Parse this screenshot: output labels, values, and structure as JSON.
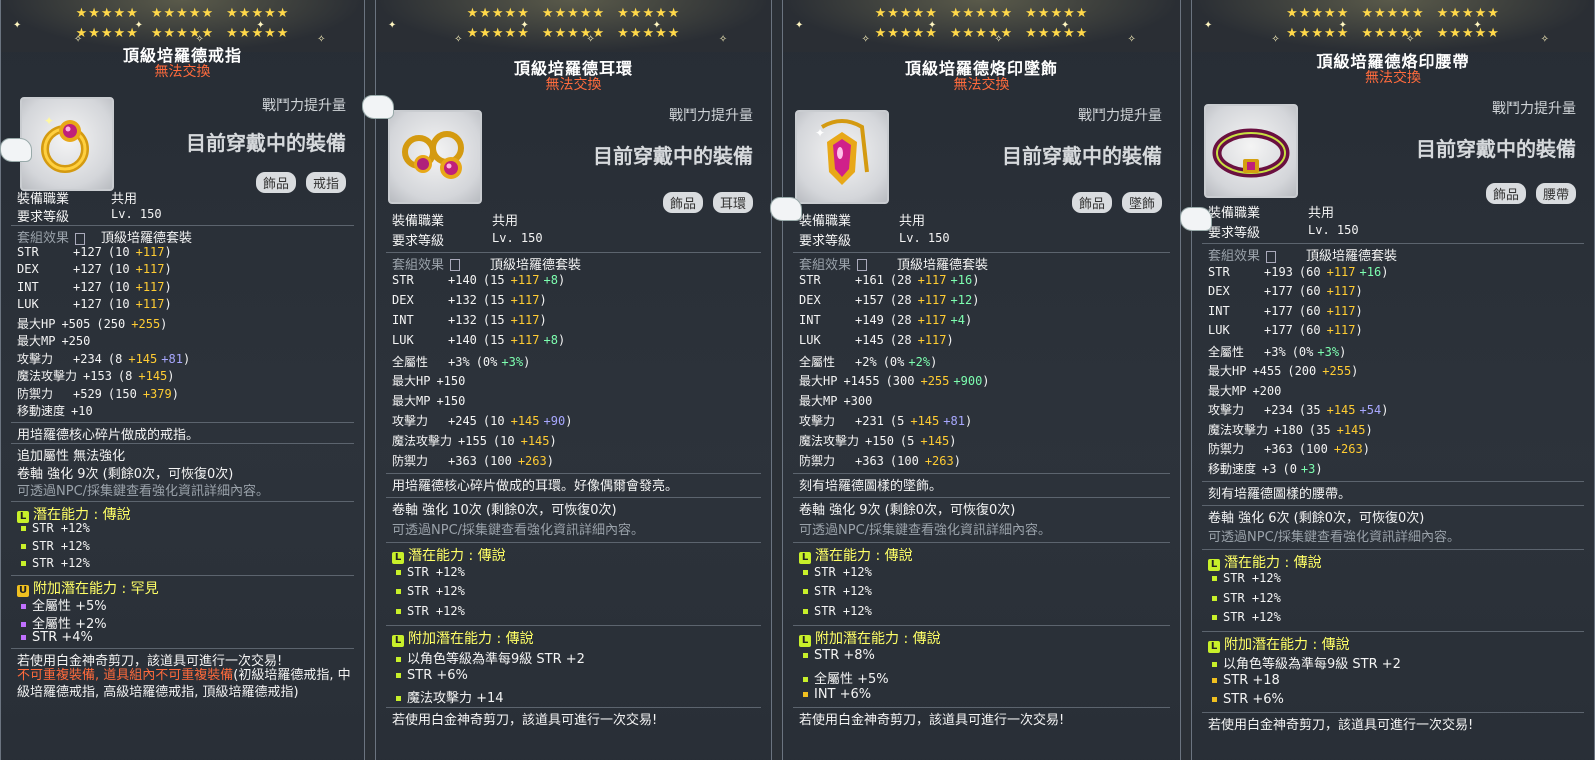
{
  "labels": {
    "combat_increase": "戰鬥力提升量",
    "currently_equipped": "目前穿戴中的裝備",
    "job": "裝備職業",
    "job_value": "共用",
    "req_level": "要求等級",
    "req_level_value": "Lv. 150",
    "set_effect": "套組效果",
    "set_name": "頂級培羅德套裝",
    "not_tradeable": "無法交換",
    "upgrade_info": "可透過NPC/採集鍵查看強化資訊詳細內容。",
    "scissors_note": "若使用白金神奇剪刀，該道具可進行一次交易!",
    "stars": "★★★★★"
  },
  "cards": [
    {
      "title": "頂級培羅德戒指",
      "tags": [
        "飾品",
        "戒指"
      ],
      "icon": "ring-icon",
      "stats": [
        {
          "k": "STR",
          "total": "+127",
          "base": "(10",
          "p1": "+117",
          "p2": "",
          "p2c": "",
          "close": ")"
        },
        {
          "k": "DEX",
          "total": "+127",
          "base": "(10",
          "p1": "+117",
          "p2": "",
          "p2c": "",
          "close": ")"
        },
        {
          "k": "INT",
          "total": "+127",
          "base": "(10",
          "p1": "+117",
          "p2": "",
          "p2c": "",
          "close": ")"
        },
        {
          "k": "LUK",
          "total": "+127",
          "base": "(10",
          "p1": "+117",
          "p2": "",
          "p2c": "",
          "close": ")"
        },
        {
          "k": "最大HP",
          "total": "+505",
          "base": "(250",
          "p1": "+255",
          "p2": "",
          "p2c": "",
          "close": ")"
        },
        {
          "k": "最大MP",
          "total": "+250",
          "base": "",
          "p1": "",
          "p2": "",
          "p2c": "",
          "close": ""
        },
        {
          "k": "攻擊力",
          "total": "+234",
          "base": "(8",
          "p1": "+145",
          "p2": "+81",
          "p2c": "blue",
          "close": ")"
        },
        {
          "k": "魔法攻擊力",
          "total": "+153",
          "base": "(8",
          "p1": "+145",
          "p2": "",
          "p2c": "",
          "close": ")"
        },
        {
          "k": "防禦力",
          "total": "+529",
          "base": "(150",
          "p1": "+379",
          "p2": "",
          "p2c": "",
          "close": ")"
        },
        {
          "k": "移動速度",
          "total": "+10",
          "base": "",
          "p1": "",
          "p2": "",
          "p2c": "",
          "close": ""
        }
      ],
      "desc": "用培羅德核心碎片做成的戒指。",
      "extra": "追加屬性 無法強化",
      "scroll": "卷軸 強化 9次 (剩餘0次，可恢復0次)",
      "potential_title": "潛在能力 : 傳說",
      "potential_badge": "L",
      "potential": [
        "STR +12%",
        "STR +12%",
        "STR +12%"
      ],
      "bonus_title": "附加潛在能力 : 罕見",
      "bonus_badge": "U",
      "bonus": [
        "全屬性 +5%",
        "全屬性 +2%",
        "STR +4%"
      ],
      "bonus_bullet": [
        "#c070ff",
        "#c070ff",
        "#c070ff"
      ],
      "scissors": "若使用白金神奇剪刀，該道具可進行一次交易!",
      "unique_red": "不可重複裝備, 道具組內不可重複裝備",
      "unique_rest": "(初級培羅德戒指, 中級培羅德戒指, 高級培羅德戒指, 頂級培羅德戒指)"
    },
    {
      "title": "頂級培羅德耳環",
      "tags": [
        "飾品",
        "耳環"
      ],
      "icon": "earring-icon",
      "stats": [
        {
          "k": "STR",
          "total": "+140",
          "base": "(15",
          "p1": "+117",
          "p2": "+8",
          "p2c": "green",
          "close": ")"
        },
        {
          "k": "DEX",
          "total": "+132",
          "base": "(15",
          "p1": "+117",
          "p2": "",
          "p2c": "",
          "close": ")"
        },
        {
          "k": "INT",
          "total": "+132",
          "base": "(15",
          "p1": "+117",
          "p2": "",
          "p2c": "",
          "close": ")"
        },
        {
          "k": "LUK",
          "total": "+140",
          "base": "(15",
          "p1": "+117",
          "p2": "+8",
          "p2c": "green",
          "close": ")"
        },
        {
          "k": "全屬性",
          "total": "+3%",
          "base": "(0%",
          "p1": "",
          "p2": "+3%",
          "p2c": "green",
          "close": ")"
        },
        {
          "k": "最大HP",
          "total": "+150",
          "base": "",
          "p1": "",
          "p2": "",
          "p2c": "",
          "close": ""
        },
        {
          "k": "最大MP",
          "total": "+150",
          "base": "",
          "p1": "",
          "p2": "",
          "p2c": "",
          "close": ""
        },
        {
          "k": "攻擊力",
          "total": "+245",
          "base": "(10",
          "p1": "+145",
          "p2": "+90",
          "p2c": "blue",
          "close": ")"
        },
        {
          "k": "魔法攻擊力",
          "total": "+155",
          "base": "(10",
          "p1": "+145",
          "p2": "",
          "p2c": "",
          "close": ")"
        },
        {
          "k": "防禦力",
          "total": "+363",
          "base": "(100",
          "p1": "+263",
          "p2": "",
          "p2c": "",
          "close": ")"
        }
      ],
      "desc": "用培羅德核心碎片做成的耳環。好像偶爾會發亮。",
      "scroll": "卷軸 強化 10次 (剩餘0次，可恢復0次)",
      "potential_title": "潛在能力 : 傳說",
      "potential_badge": "L",
      "potential": [
        "STR +12%",
        "STR +12%",
        "STR +12%"
      ],
      "bonus_title": "附加潛在能力 : 傳說",
      "bonus_badge": "L",
      "bonus": [
        "以角色等級為準每9級 STR +2",
        "STR +6%",
        "魔法攻擊力 +14"
      ],
      "bonus_bullet": [
        "#c8f02a",
        "#c8f02a",
        "#c8f02a"
      ],
      "scissors": "若使用白金神奇剪刀，該道具可進行一次交易!"
    },
    {
      "title": "頂級培羅德烙印墜飾",
      "tags": [
        "飾品",
        "墜飾"
      ],
      "icon": "pendant-icon",
      "stats": [
        {
          "k": "STR",
          "total": "+161",
          "base": "(28",
          "p1": "+117",
          "p2": "+16",
          "p2c": "green",
          "close": ")"
        },
        {
          "k": "DEX",
          "total": "+157",
          "base": "(28",
          "p1": "+117",
          "p2": "+12",
          "p2c": "green",
          "close": ")"
        },
        {
          "k": "INT",
          "total": "+149",
          "base": "(28",
          "p1": "+117",
          "p2": "+4",
          "p2c": "green",
          "close": ")"
        },
        {
          "k": "LUK",
          "total": "+145",
          "base": "(28",
          "p1": "+117",
          "p2": "",
          "p2c": "",
          "close": ")"
        },
        {
          "k": "全屬性",
          "total": "+2%",
          "base": "(0%",
          "p1": "",
          "p2": "+2%",
          "p2c": "green",
          "close": ")"
        },
        {
          "k": "最大HP",
          "total": "+1455",
          "base": "(300",
          "p1": "+255",
          "p2": "+900",
          "p2c": "green",
          "close": ")"
        },
        {
          "k": "最大MP",
          "total": "+300",
          "base": "",
          "p1": "",
          "p2": "",
          "p2c": "",
          "close": ""
        },
        {
          "k": "攻擊力",
          "total": "+231",
          "base": "(5",
          "p1": "+145",
          "p2": "+81",
          "p2c": "blue",
          "close": ")"
        },
        {
          "k": "魔法攻擊力",
          "total": "+150",
          "base": "(5",
          "p1": "+145",
          "p2": "",
          "p2c": "",
          "close": ")"
        },
        {
          "k": "防禦力",
          "total": "+363",
          "base": "(100",
          "p1": "+263",
          "p2": "",
          "p2c": "",
          "close": ")"
        }
      ],
      "desc": "刻有培羅德圖樣的墜飾。",
      "scroll": "卷軸 強化 9次 (剩餘0次，可恢復0次)",
      "potential_title": "潛在能力 : 傳說",
      "potential_badge": "L",
      "potential": [
        "STR +12%",
        "STR +12%",
        "STR +12%"
      ],
      "bonus_title": "附加潛在能力 : 傳說",
      "bonus_badge": "L",
      "bonus": [
        "STR +8%",
        "全屬性 +5%",
        "INT +6%"
      ],
      "bonus_bullet": [
        "#c8f02a",
        "#c8f02a",
        "#f0c020"
      ],
      "scissors": "若使用白金神奇剪刀，該道具可進行一次交易!"
    },
    {
      "title": "頂級培羅德烙印腰帶",
      "tags": [
        "飾品",
        "腰帶"
      ],
      "icon": "belt-icon",
      "stats": [
        {
          "k": "STR",
          "total": "+193",
          "base": "(60",
          "p1": "+117",
          "p2": "+16",
          "p2c": "green",
          "close": ")"
        },
        {
          "k": "DEX",
          "total": "+177",
          "base": "(60",
          "p1": "+117",
          "p2": "",
          "p2c": "",
          "close": ")"
        },
        {
          "k": "INT",
          "total": "+177",
          "base": "(60",
          "p1": "+117",
          "p2": "",
          "p2c": "",
          "close": ")"
        },
        {
          "k": "LUK",
          "total": "+177",
          "base": "(60",
          "p1": "+117",
          "p2": "",
          "p2c": "",
          "close": ")"
        },
        {
          "k": "全屬性",
          "total": "+3%",
          "base": "(0%",
          "p1": "",
          "p2": "+3%",
          "p2c": "green",
          "close": ")"
        },
        {
          "k": "最大HP",
          "total": "+455",
          "base": "(200",
          "p1": "+255",
          "p2": "",
          "p2c": "",
          "close": ")"
        },
        {
          "k": "最大MP",
          "total": "+200",
          "base": "",
          "p1": "",
          "p2": "",
          "p2c": "",
          "close": ""
        },
        {
          "k": "攻擊力",
          "total": "+234",
          "base": "(35",
          "p1": "+145",
          "p2": "+54",
          "p2c": "blue",
          "close": ")"
        },
        {
          "k": "魔法攻擊力",
          "total": "+180",
          "base": "(35",
          "p1": "+145",
          "p2": "",
          "p2c": "",
          "close": ")"
        },
        {
          "k": "防禦力",
          "total": "+363",
          "base": "(100",
          "p1": "+263",
          "p2": "",
          "p2c": "",
          "close": ")"
        },
        {
          "k": "移動速度",
          "total": "+3",
          "base": "(0",
          "p1": "",
          "p2": "+3",
          "p2c": "green",
          "close": ")"
        }
      ],
      "desc": "刻有培羅德圖樣的腰帶。",
      "scroll": "卷軸 強化 6次 (剩餘0次，可恢復0次)",
      "potential_title": "潛在能力 : 傳說",
      "potential_badge": "L",
      "potential": [
        "STR +12%",
        "STR +12%",
        "STR +12%"
      ],
      "bonus_title": "附加潛在能力 : 傳說",
      "bonus_badge": "L",
      "bonus": [
        "以角色等級為準每9級 STR +2",
        "STR +18",
        "STR +6%"
      ],
      "bonus_bullet": [
        "#c8f02a",
        "#f0c020",
        "#f0c020"
      ],
      "scissors": "若使用白金神奇剪刀，該道具可進行一次交易!"
    }
  ]
}
